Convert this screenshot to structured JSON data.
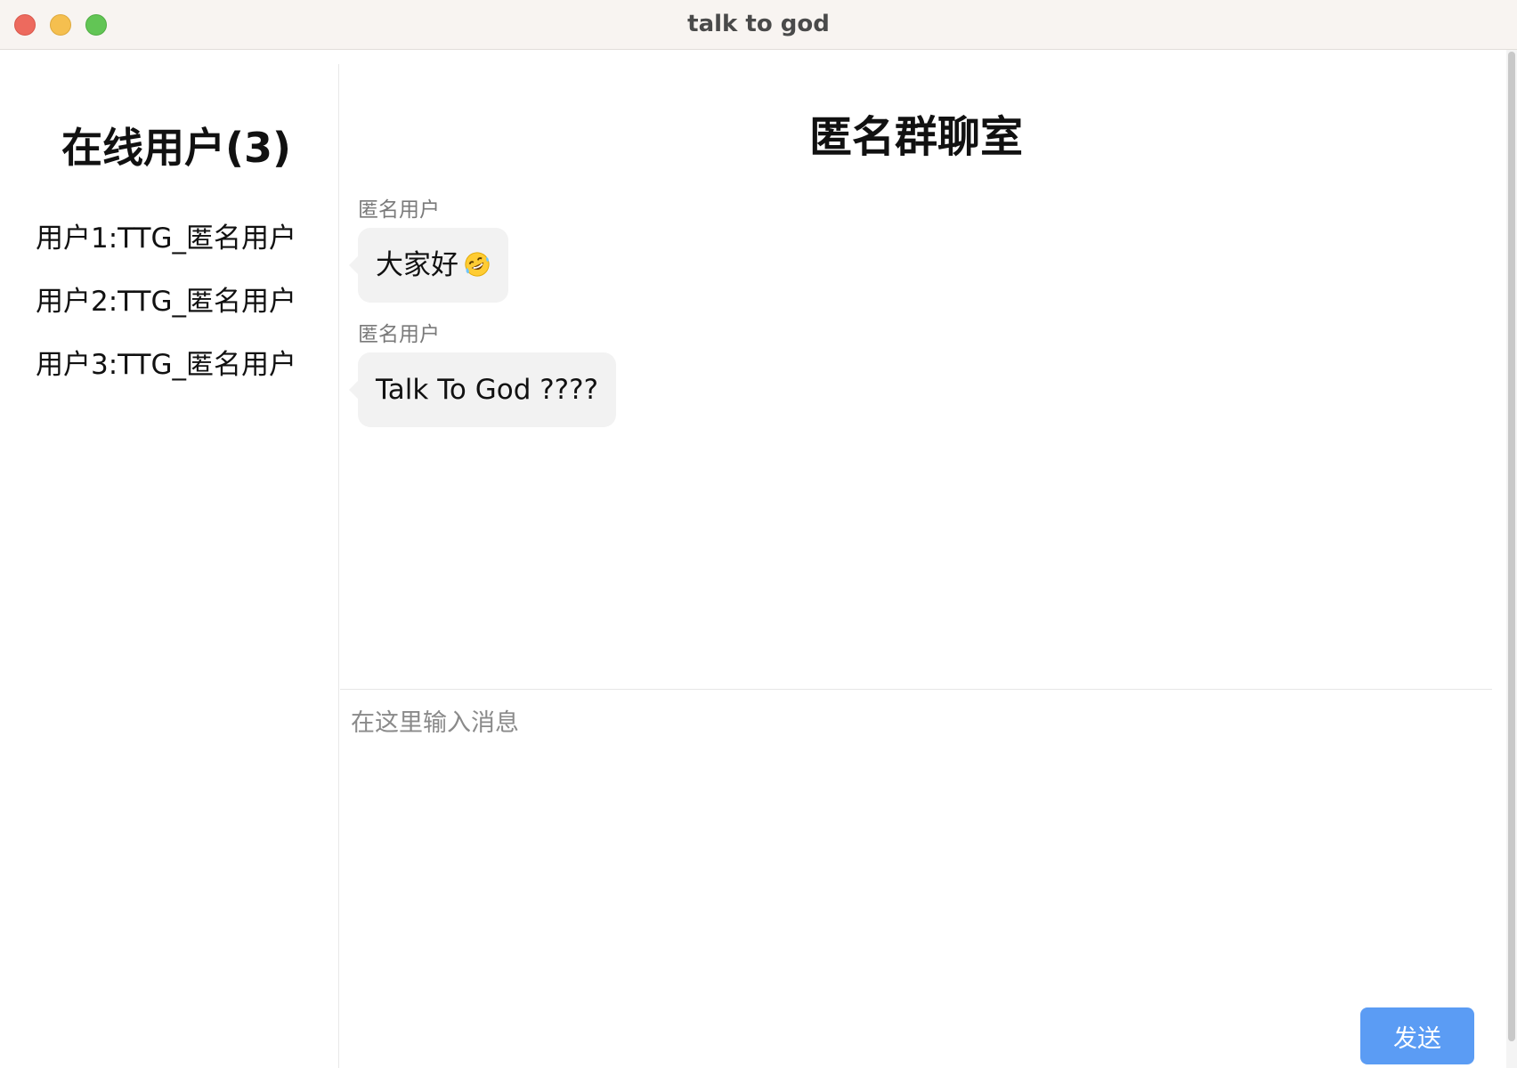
{
  "window": {
    "title": "talk to god"
  },
  "sidebar": {
    "title": "在线用户(3)",
    "users": [
      "用户1:TTG_匿名用户",
      "用户2:TTG_匿名用户",
      "用户3:TTG_匿名用户"
    ]
  },
  "chat": {
    "title": "匿名群聊室",
    "messages": [
      {
        "sender": "匿名用户",
        "text": "大家好",
        "emoji": "rofl-emoji-icon"
      },
      {
        "sender": "匿名用户",
        "text": "Talk To God ????"
      }
    ]
  },
  "composer": {
    "placeholder": "在这里输入消息",
    "value": "",
    "send_label": "发送"
  },
  "colors": {
    "accent": "#5b9cf4",
    "bubble": "#f2f2f2",
    "titlebar": "#f8f4f1"
  }
}
